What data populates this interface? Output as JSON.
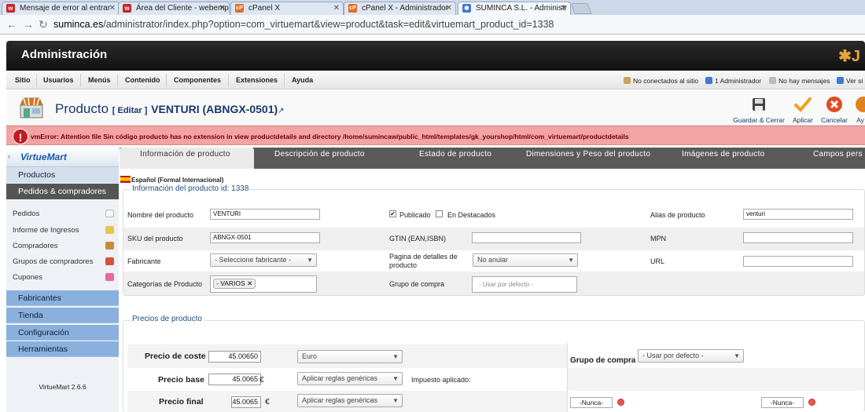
{
  "browser": {
    "tabs": [
      {
        "label": "Mensaje de error al entrar",
        "favicon": "webempresa-icon"
      },
      {
        "label": "Área del Cliente - webemp",
        "favicon": "webempresa-icon"
      },
      {
        "label": "cPanel X",
        "favicon": "cpanel-icon"
      },
      {
        "label": "cPanel X - Administrador",
        "favicon": "cpanel-icon"
      },
      {
        "label": "SUMINCA S.L. - Administr",
        "favicon": "joomla-icon"
      }
    ],
    "url_host": "suminca.es",
    "url_path": "/administrator/index.php?option=com_virtuemart&view=product&task=edit&virtuemart_product_id=1338"
  },
  "header": {
    "title": "Administración"
  },
  "menu": [
    "Sitio",
    "Usuarios",
    "Menús",
    "Contenido",
    "Componentes",
    "Extensiones",
    "Ayuda"
  ],
  "status": [
    "No conectados al sitio",
    "1 Administrador",
    "No hay mensajes",
    "Ver si"
  ],
  "page": {
    "title": "Producto",
    "edit": "[ Editar ]",
    "product_name": "VENTURI (ABNGX-0501)"
  },
  "toolbar": {
    "save_close": "Guardar & Cerrar",
    "apply": "Aplicar",
    "cancel": "Cancelar",
    "help": "Ay"
  },
  "error": "vmError: Attention file Sin código producto has no extension in view productdetails and directory /home/sumincaw/public_html/templates/gk_yourshop/html/com_virtuemart/productdetails",
  "sidebar": {
    "logo": "VirtueMart",
    "sections": [
      "Productos",
      "Pedidos & compradores"
    ],
    "items": [
      "Pedidos",
      "Informe de Ingresos",
      "Compradores",
      "Grupos de compradores",
      "Cupones"
    ],
    "sections2": [
      "Fabricantes",
      "Tienda",
      "Configuración",
      "Herramientas"
    ],
    "version": "VirtueMart 2.6.6"
  },
  "tabs": [
    "Información de producto",
    "Descripción de producto",
    "Estado de producto",
    "Dimensiones y Peso del producto",
    "Imágenes de producto",
    "Campos pers"
  ],
  "language": "Español (Formal Internacional)",
  "info_legend": "Información del producto id: 1338",
  "form": {
    "name_label": "Nombre del producto",
    "name_value": "VENTURI",
    "published_label": "Publicado",
    "featured_label": "En Destacados",
    "alias_label": "Alias de producto",
    "alias_value": "venturi",
    "sku_label": "SKU del producto",
    "sku_value": "ABNGX-0501",
    "gtin_label": "GTIN (EAN,ISBN)",
    "mpn_label": "MPN",
    "manufacturer_label": "Fabricante",
    "manufacturer_value": "- Seleccione fabricante -",
    "details_page_label": "Pagina de detalles de producto",
    "details_page_value": "No anular",
    "url_label": "URL",
    "categories_label": "Categorías de Producto",
    "category_tag": "- VARIOS",
    "group_label": "Grupo de compra",
    "group_placeholder": "- Usar por defecto -"
  },
  "prices": {
    "legend": "Precios de producto",
    "cost_label": "Precio de coste",
    "cost_value": "45.00650",
    "currency": "Euro",
    "base_label": "Precio base",
    "base_value": "45.0065",
    "euro_sign": "€",
    "rules": "Aplicar reglas genéricas",
    "tax_label": "Impuesto aplicado:",
    "final_label": "Precio final",
    "final_value": "45.0065",
    "rules2": "Aplicar reglas genéricas",
    "group_label": "Grupo de compra",
    "group_value": "- Usar por defecto -",
    "never1": "-Nunca-",
    "never2": "-Nunca-"
  }
}
